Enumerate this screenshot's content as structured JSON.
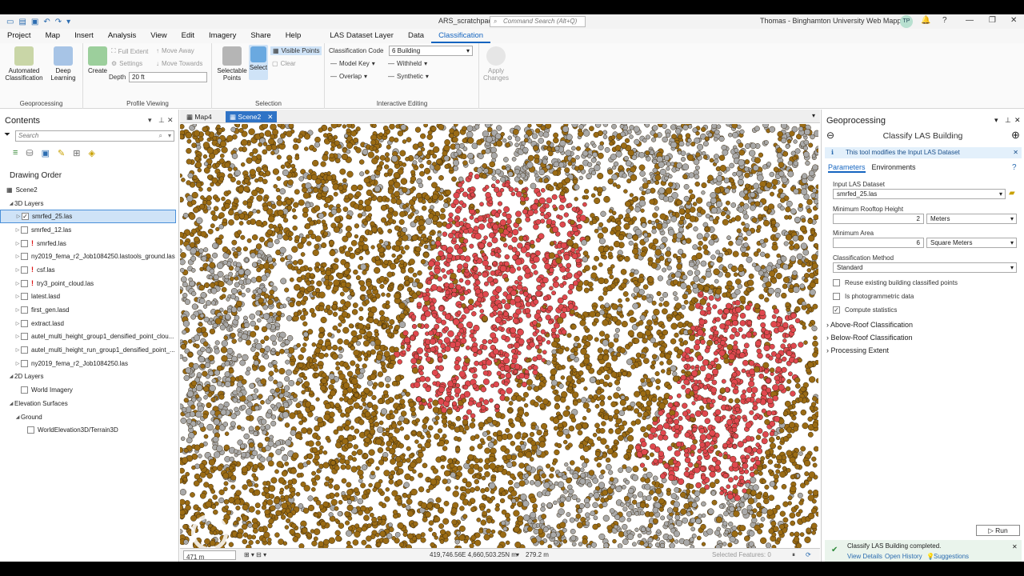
{
  "window": {
    "doc_title": "ARS_scratchpad",
    "command_search_placeholder": "Command Search (Alt+Q)",
    "user": "Thomas - Binghamton University Web Mapping",
    "avatar_initials": "TP"
  },
  "ribbon_tabs": [
    "Project",
    "Map",
    "Insert",
    "Analysis",
    "View",
    "Edit",
    "Imagery",
    "Share",
    "Help"
  ],
  "context_tabs": [
    "LAS Dataset Layer",
    "Data",
    "Classification"
  ],
  "active_tab": "Classification",
  "ribbon": {
    "geoprocessing": {
      "label": "Geoprocessing",
      "auto": "Automated Classification",
      "deep": "Deep Learning"
    },
    "profile": {
      "label": "Profile Viewing",
      "create": "Create",
      "full_extent": "Full Extent",
      "settings": "Settings",
      "move_away": "Move Away",
      "move_towards": "Move Towards",
      "depth_label": "Depth",
      "depth_value": "20 ft"
    },
    "selection": {
      "label": "Selection",
      "selectable": "Selectable Points",
      "select": "Select",
      "visible_points": "Visible Points",
      "clear": "Clear"
    },
    "interactive": {
      "label": "Interactive Editing",
      "class_code_label": "Classification Code",
      "class_code_value": "6 Building",
      "model_key": "Model Key",
      "withheld": "Withheld",
      "overlap": "Overlap",
      "synthetic": "Synthetic"
    },
    "apply": "Apply Changes"
  },
  "contents": {
    "title": "Contents",
    "search_placeholder": "Search",
    "drawing_order": "Drawing Order",
    "scene": "Scene2",
    "layers_3d_header": "3D Layers",
    "layers_3d": [
      {
        "name": "smrfed_25.las",
        "checked": true,
        "warn": false
      },
      {
        "name": "smrfed_12.las",
        "checked": false,
        "warn": false
      },
      {
        "name": "smrfed.las",
        "checked": false,
        "warn": true
      },
      {
        "name": "ny2019_fema_r2_Job1084250.lastools_ground.las",
        "checked": false,
        "warn": false
      },
      {
        "name": "csf.las",
        "checked": false,
        "warn": true
      },
      {
        "name": "try3_point_cloud.las",
        "checked": false,
        "warn": true
      },
      {
        "name": "latest.lasd",
        "checked": false,
        "warn": false
      },
      {
        "name": "first_gen.lasd",
        "checked": false,
        "warn": false
      },
      {
        "name": "extract.lasd",
        "checked": false,
        "warn": false
      },
      {
        "name": "autel_multi_height_group1_densified_point_clou...",
        "checked": false,
        "warn": false
      },
      {
        "name": "autel_multi_height_run_group1_densified_point_...",
        "checked": false,
        "warn": false
      },
      {
        "name": "ny2019_fema_r2_Job1084250.las",
        "checked": false,
        "warn": false
      }
    ],
    "layers_2d_header": "2D Layers",
    "world_imagery": "World Imagery",
    "elevation_header": "Elevation Surfaces",
    "ground": "Ground",
    "terrain": "WorldElevation3D/Terrain3D"
  },
  "map_tabs": [
    "Map4",
    "Scene2"
  ],
  "active_map_tab": "Scene2",
  "status": {
    "scale": "471 m",
    "coords": "419,746.56E 4,660,503.25N m",
    "elevation": "279.2 m",
    "selected": "Selected Features: 0"
  },
  "geoprocessing": {
    "title": "Geoprocessing",
    "tool": "Classify LAS Building",
    "info": "This tool modifies the Input LAS Dataset",
    "tabs": [
      "Parameters",
      "Environments"
    ],
    "input_label": "Input LAS Dataset",
    "input_value": "smrfed_25.las",
    "min_roof_label": "Minimum Rooftop Height",
    "min_roof_value": "2",
    "min_roof_unit": "Meters",
    "min_area_label": "Minimum Area",
    "min_area_value": "6",
    "min_area_unit": "Square Meters",
    "method_label": "Classification Method",
    "method_value": "Standard",
    "chk_reuse": "Reuse existing building classified points",
    "chk_photo": "Is photogrammetric data",
    "chk_stats": "Compute statistics",
    "sections": [
      "Above-Roof Classification",
      "Below-Roof Classification",
      "Processing Extent"
    ],
    "run": "Run",
    "completed": "Classify LAS Building completed.",
    "view_details": "View Details",
    "open_history": "Open History",
    "suggestions": "Suggestions"
  },
  "colors": {
    "accent": "#1565c0",
    "ground": "#9a6b14",
    "building": "#e0484f",
    "unclassified": "#a9a9a9"
  }
}
